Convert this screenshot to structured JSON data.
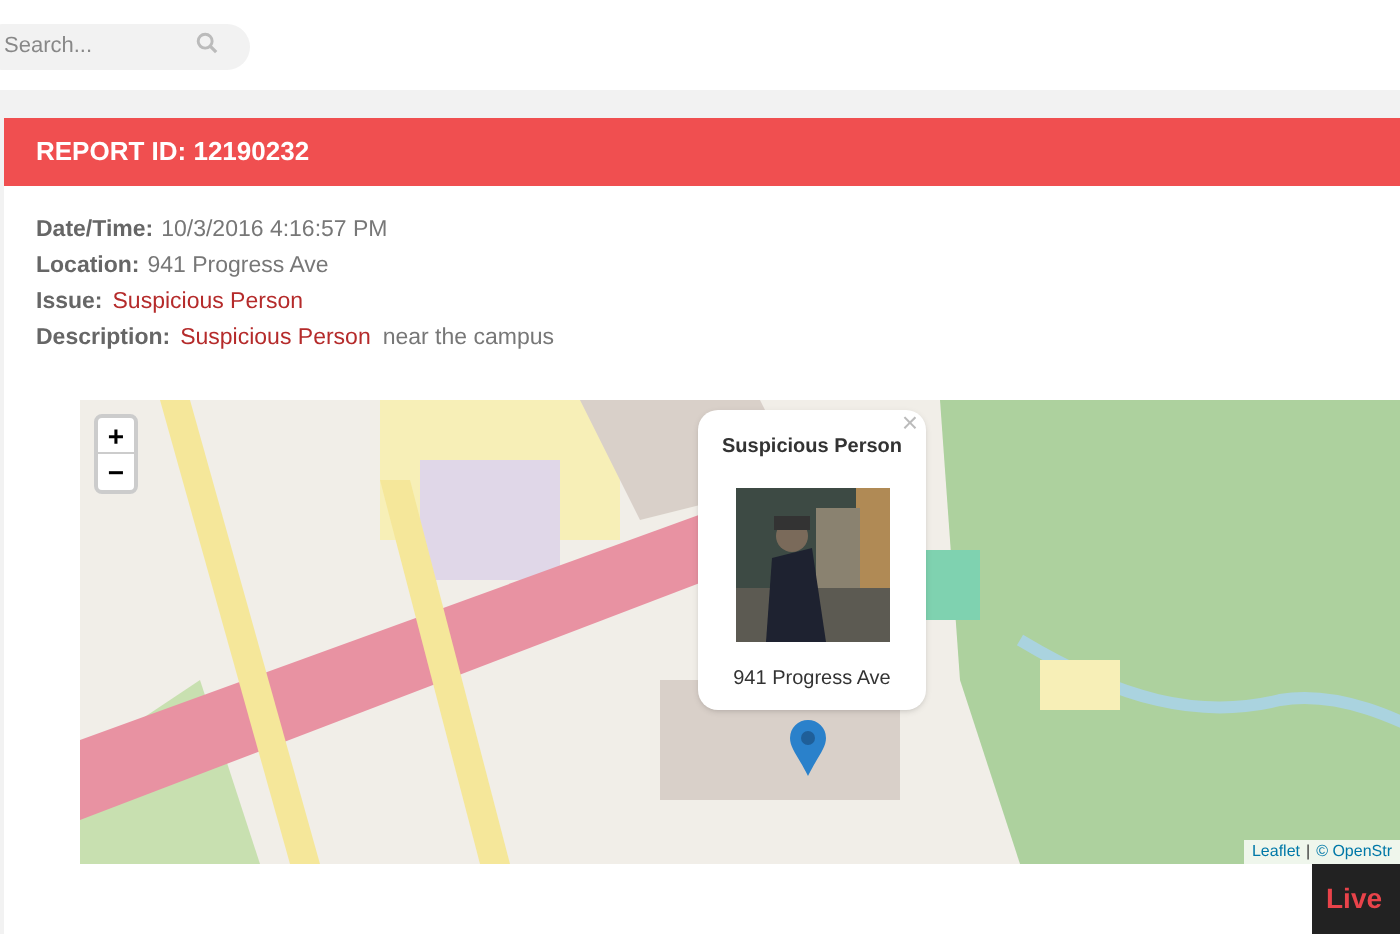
{
  "search": {
    "placeholder": "Search..."
  },
  "report": {
    "title": "REPORT ID: 12190232",
    "fields": [
      {
        "label": "Date/Time:",
        "value": "10/3/2016 4:16:57 PM",
        "kind": "plain"
      },
      {
        "label": "Location:",
        "value": "941 Progress Ave",
        "kind": "plain"
      },
      {
        "label": "Issue:",
        "value": "Suspicious Person",
        "kind": "highlight"
      },
      {
        "label": "Description:",
        "value": "Suspicious Person",
        "extra": "near the campus",
        "kind": "highlight"
      }
    ]
  },
  "map": {
    "zoom_in": "+",
    "zoom_out": "−",
    "popup": {
      "title": "Suspicious Person",
      "close": "×",
      "address": "941 Progress Ave"
    },
    "attribution": {
      "link": "Leaflet",
      "separator": "|",
      "source": "© OpenStr"
    }
  },
  "live_button": "Live"
}
